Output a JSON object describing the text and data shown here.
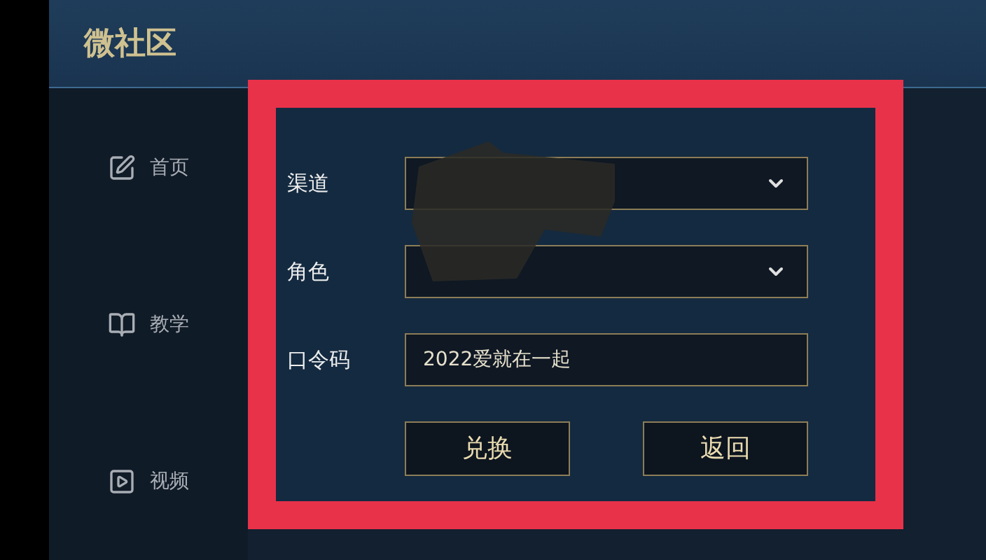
{
  "header": {
    "title": "微社区"
  },
  "sidebar": {
    "items": [
      {
        "label": "首页",
        "kind": "home"
      },
      {
        "label": "教学",
        "kind": "book"
      },
      {
        "label": "视频",
        "kind": "video"
      }
    ]
  },
  "form": {
    "fields": [
      {
        "label": "渠道",
        "kind": "select"
      },
      {
        "label": "角色",
        "kind": "select"
      },
      {
        "label": "口令码",
        "kind": "text",
        "value": "2022爱就在一起"
      }
    ],
    "buttons": [
      {
        "label": "兑换"
      },
      {
        "label": "返回"
      }
    ]
  }
}
